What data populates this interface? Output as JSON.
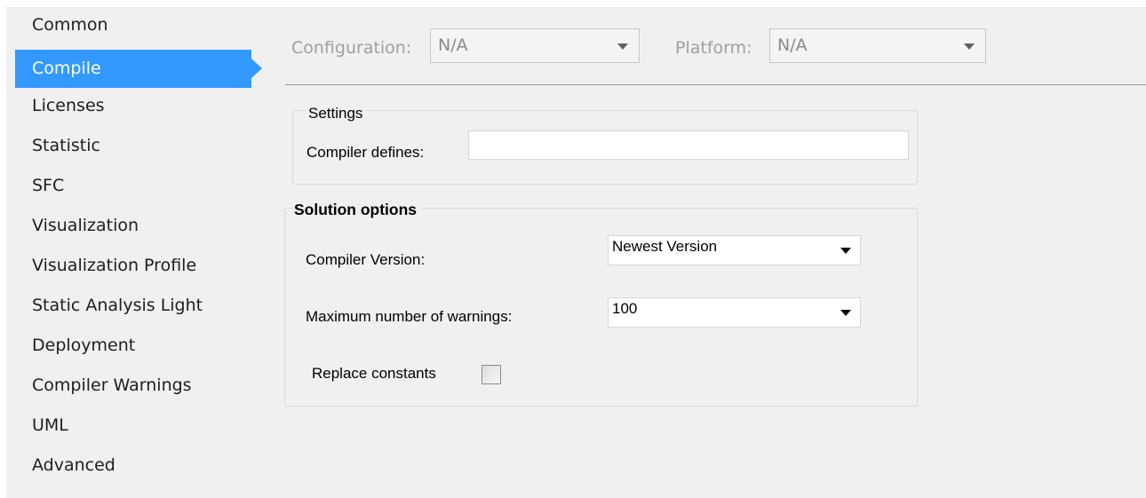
{
  "sidebar": {
    "items": [
      {
        "label": "Common"
      },
      {
        "label": "Compile",
        "selected": true
      },
      {
        "label": "Licenses"
      },
      {
        "label": "Statistic"
      },
      {
        "label": "SFC"
      },
      {
        "label": "Visualization"
      },
      {
        "label": "Visualization Profile"
      },
      {
        "label": "Static Analysis Light"
      },
      {
        "label": "Deployment"
      },
      {
        "label": "Compiler Warnings"
      },
      {
        "label": "UML"
      },
      {
        "label": "Advanced"
      }
    ]
  },
  "config_bar": {
    "configuration_label": "Configuration:",
    "configuration_value": "N/A",
    "platform_label": "Platform:",
    "platform_value": "N/A"
  },
  "settings": {
    "title": "Settings",
    "compiler_defines_label": "Compiler defines:",
    "compiler_defines_value": ""
  },
  "solution_options": {
    "title": "Solution options",
    "compiler_version_label": "Compiler Version:",
    "compiler_version_value": "Newest Version",
    "max_warnings_label": "Maximum number of warnings:",
    "max_warnings_value": "100",
    "replace_constants_label": "Replace constants",
    "replace_constants_checked": false
  },
  "colors": {
    "selection": "#3399ff",
    "background": "#f0f0f0"
  }
}
